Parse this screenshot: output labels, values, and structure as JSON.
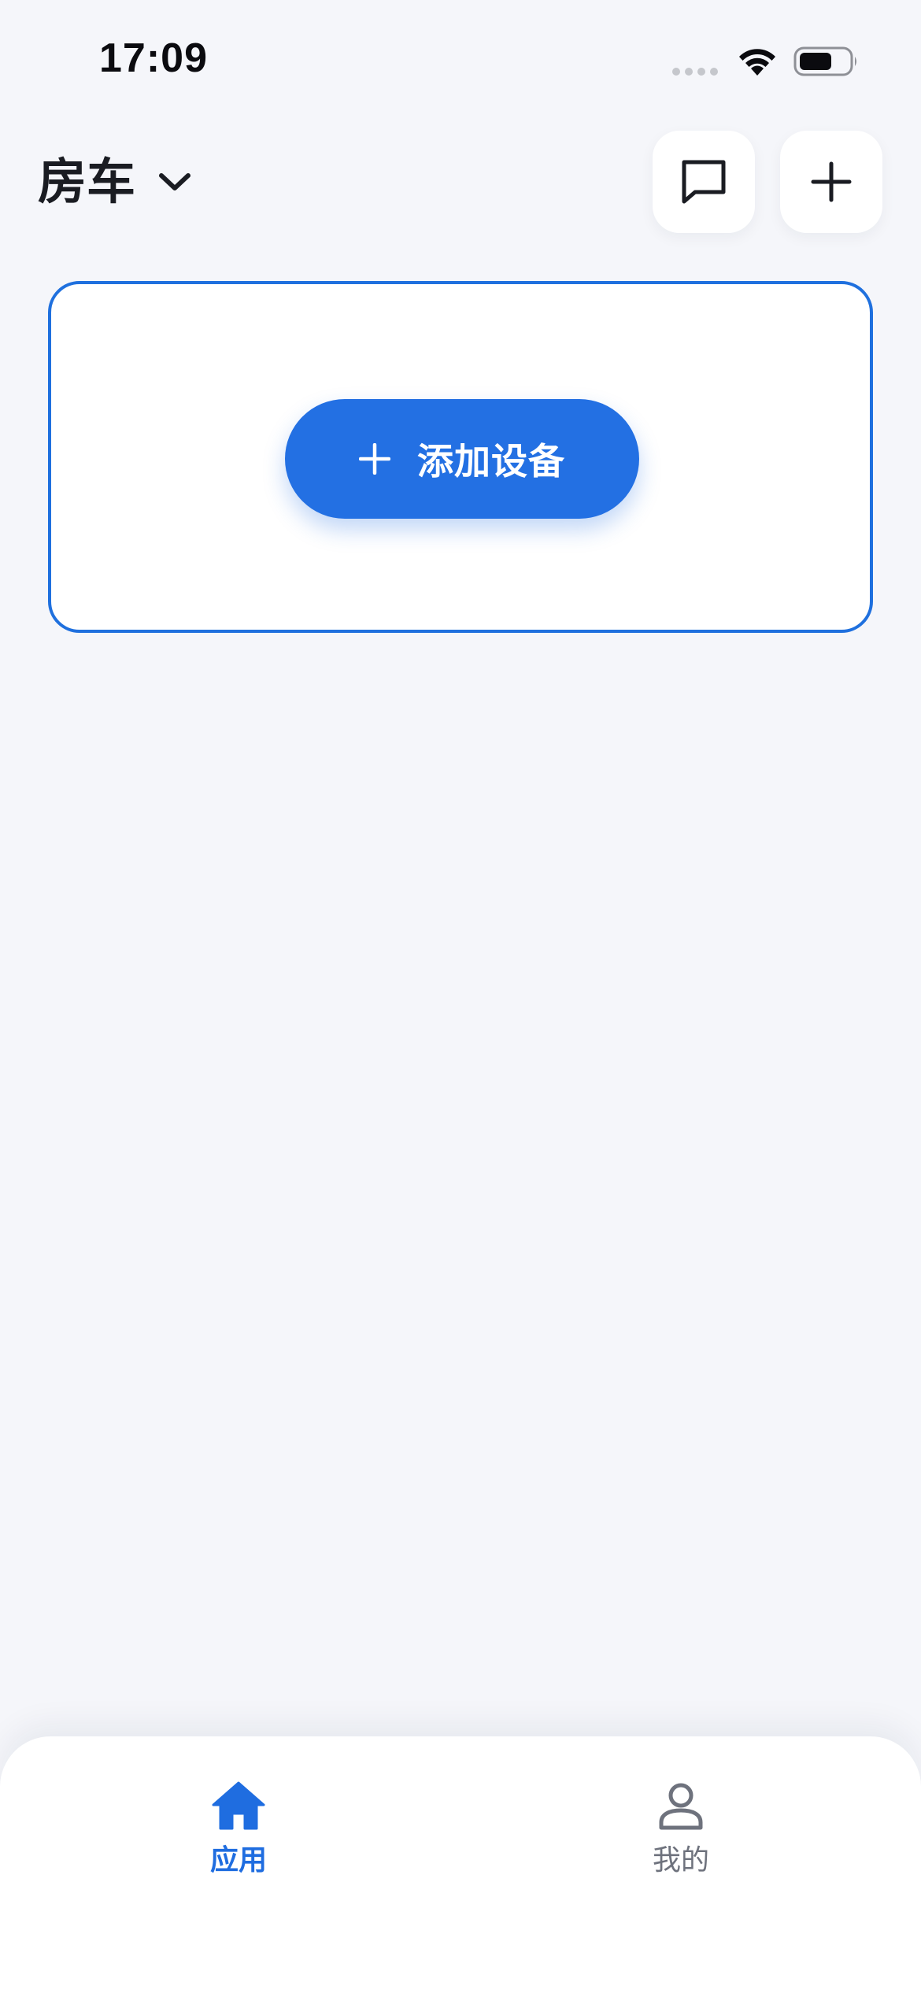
{
  "status_bar": {
    "time": "17:09",
    "icons": [
      "cellular-signal-icon",
      "wifi-icon",
      "battery-icon"
    ]
  },
  "header": {
    "home_name": "房车",
    "home_dropdown_icon": "chevron-down-icon",
    "message_button_icon": "message-icon",
    "add_button_icon": "plus-icon"
  },
  "device_card": {
    "add_device_label": "添加设备",
    "add_device_icon": "plus-icon"
  },
  "tab_bar": {
    "tabs": [
      {
        "label": "应用",
        "icon": "home-icon",
        "active": true
      },
      {
        "label": "我的",
        "icon": "user-icon",
        "active": false
      }
    ]
  },
  "colors": {
    "background": "#f5f6fa",
    "accent": "#2370e3",
    "card_border": "#1f70de",
    "inactive_tab": "#6e727d",
    "text_primary": "#1a1c22"
  }
}
